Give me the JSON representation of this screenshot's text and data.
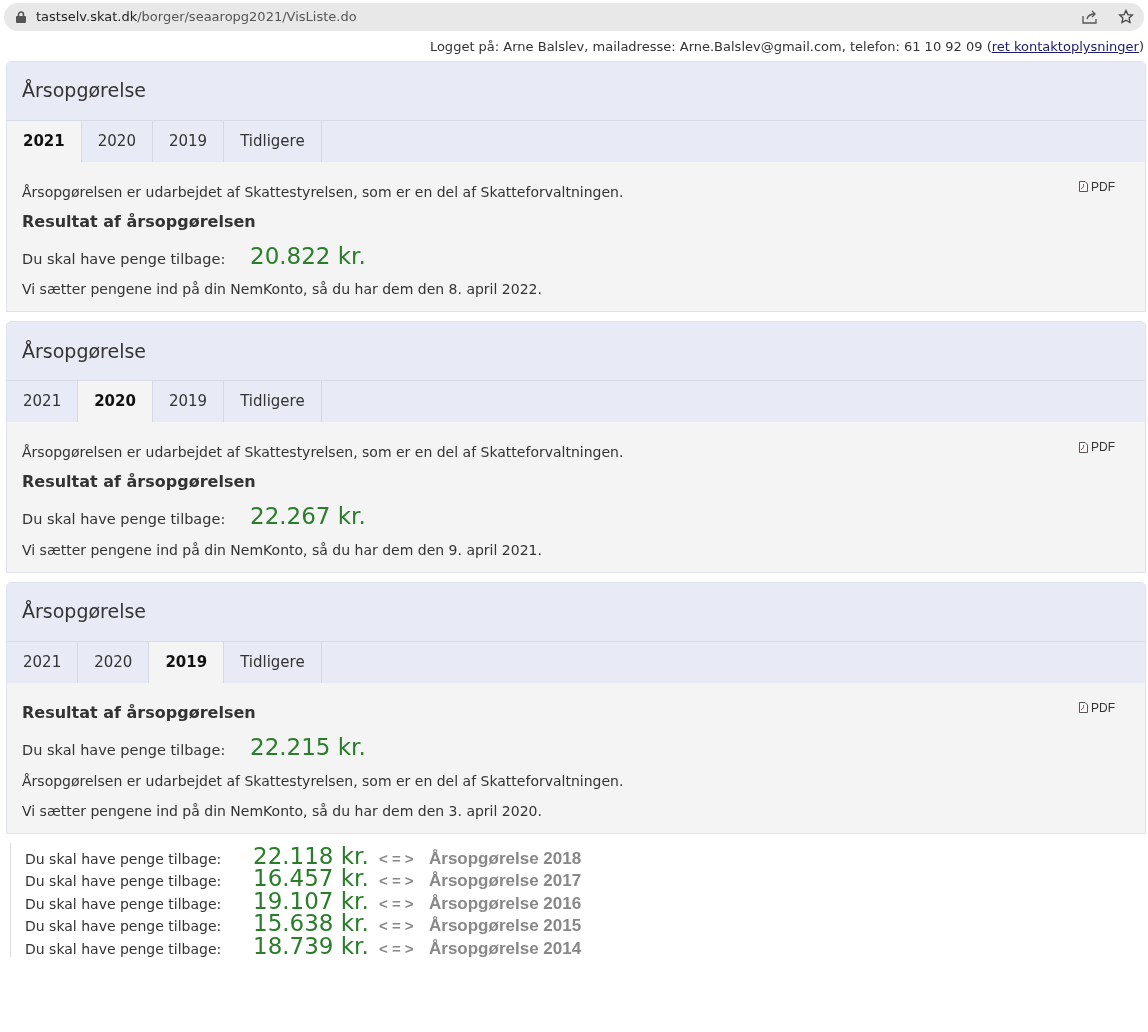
{
  "address_bar": {
    "host": "tastselv.skat.dk",
    "path": "/borger/seaaropg2021/VisListe.do"
  },
  "login_info": {
    "text": "Logget på: Arne Balslev, mailadresse: Arne.Balslev@gmail.com, telefon: 61 10 92 09 (",
    "link": "ret kontaktoplysninger",
    "closing": ")"
  },
  "panels": [
    {
      "title": "Årsopgørelse",
      "tabs": [
        {
          "label": "2021",
          "selected": true
        },
        {
          "label": "2020",
          "selected": false
        },
        {
          "label": "2019",
          "selected": false
        },
        {
          "label": "Tidligere",
          "selected": false
        }
      ],
      "pdf_link": "PDF",
      "content": [
        {
          "kind": "text",
          "text": "Årsopgørelsen er udarbejdet af Skattestyrelsen, som er en del af Skatteforvaltningen."
        },
        {
          "kind": "heading",
          "text": "Resultat af årsopgørelsen"
        },
        {
          "kind": "amount",
          "label": "Du skal have penge tilbage:",
          "value": "20.822 kr."
        },
        {
          "kind": "text",
          "text": "Vi sætter pengene ind på din NemKonto, så du har dem den 8. april 2022."
        }
      ]
    },
    {
      "title": "Årsopgørelse",
      "tabs": [
        {
          "label": "2021",
          "selected": false
        },
        {
          "label": "2020",
          "selected": true
        },
        {
          "label": "2019",
          "selected": false
        },
        {
          "label": "Tidligere",
          "selected": false
        }
      ],
      "pdf_link": "PDF",
      "content": [
        {
          "kind": "text",
          "text": "Årsopgørelsen er udarbejdet af Skattestyrelsen, som er en del af Skatteforvaltningen."
        },
        {
          "kind": "heading",
          "text": "Resultat af årsopgørelsen"
        },
        {
          "kind": "amount",
          "label": "Du skal have penge tilbage:",
          "value": "22.267 kr."
        },
        {
          "kind": "text",
          "text": "Vi sætter pengene ind på din NemKonto, så du har dem den 9. april 2021."
        }
      ]
    },
    {
      "title": "Årsopgørelse",
      "tabs": [
        {
          "label": "2021",
          "selected": false
        },
        {
          "label": "2020",
          "selected": false
        },
        {
          "label": "2019",
          "selected": true
        },
        {
          "label": "Tidligere",
          "selected": false
        }
      ],
      "pdf_link": "PDF",
      "content": [
        {
          "kind": "heading",
          "text": "Resultat af årsopgørelsen"
        },
        {
          "kind": "amount",
          "label": "Du skal have penge tilbage:",
          "value": "22.215 kr."
        },
        {
          "kind": "text",
          "text": "Årsopgørelsen er udarbejdet af Skattestyrelsen, som er en del af Skatteforvaltningen."
        },
        {
          "kind": "text",
          "text": "Vi sætter pengene ind på din NemKonto, så du har dem den 3. april 2020."
        }
      ]
    }
  ],
  "earlier_years": [
    {
      "label": "Du skal have penge tilbage:",
      "value": "22.118 kr.",
      "arrow": "< = >",
      "year_title": "Årsopgørelse 2018"
    },
    {
      "label": "Du skal have penge tilbage:",
      "value": "16.457 kr.",
      "arrow": "< = >",
      "year_title": "Årsopgørelse 2017"
    },
    {
      "label": "Du skal have penge tilbage:",
      "value": "19.107 kr.",
      "arrow": "< = >",
      "year_title": "Årsopgørelse 2016"
    },
    {
      "label": "Du skal have penge tilbage:",
      "value": "15.638 kr.",
      "arrow": "< = >",
      "year_title": "Årsopgørelse 2015"
    },
    {
      "label": "Du skal have penge tilbage:",
      "value": "18.739 kr.",
      "arrow": "< = >",
      "year_title": "Årsopgørelse 2014"
    }
  ]
}
